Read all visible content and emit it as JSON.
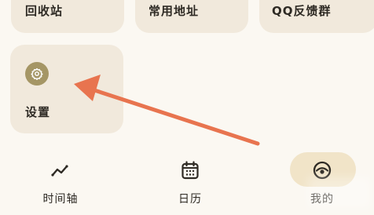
{
  "grid": {
    "recycle_label": "回收站",
    "address_label": "常用地址",
    "qq_label": "QQ反馈群",
    "settings_label": "设置"
  },
  "icons": {
    "settings": "gear-icon",
    "timeline": "trend-line-icon",
    "calendar": "calendar-icon",
    "mine": "eye-icon"
  },
  "bottom_nav": {
    "timeline_label": "时间轴",
    "calendar_label": "日历",
    "mine_label": "我的"
  },
  "colors": {
    "card_bg": "#f1e9dc",
    "accent_icon": "#a59665",
    "arrow": "#e8744f",
    "active_tab_bg": "#f1e4c8"
  }
}
